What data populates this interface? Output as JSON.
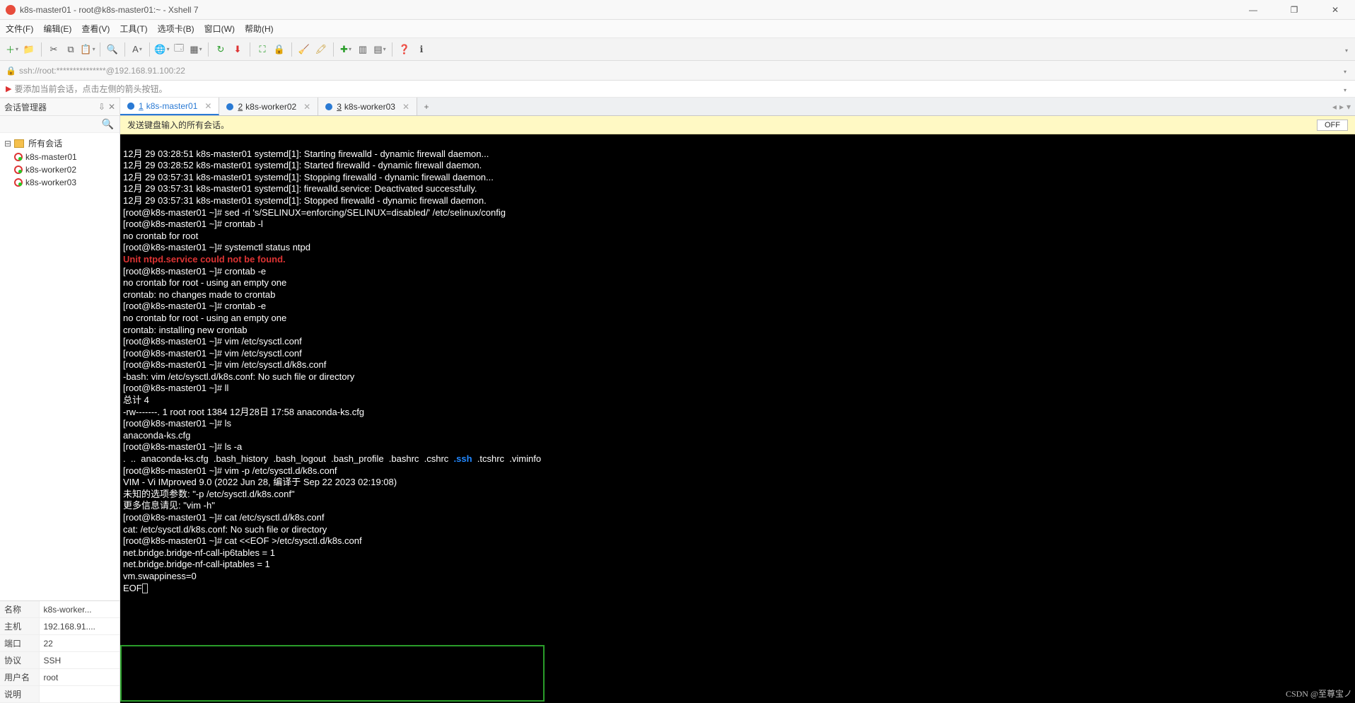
{
  "window": {
    "title": "k8s-master01 - root@k8s-master01:~ - Xshell 7",
    "min": "—",
    "max": "❐",
    "close": "✕"
  },
  "menu": {
    "file": "文件(F)",
    "edit": "编辑(E)",
    "view": "查看(V)",
    "tools": "工具(T)",
    "tab": "选项卡(B)",
    "window": "窗口(W)",
    "help": "帮助(H)"
  },
  "toolbar": {
    "new": "＋",
    "open": "📁",
    "cut": "✂",
    "copy": "⧉",
    "paste": "📋",
    "find": "🔍",
    "font": "A",
    "color": "🎨",
    "lang": "🌐",
    "props": "🗔",
    "grid": "▦",
    "refresh": "↻",
    "xftp": "⬇",
    "fullscreen": "⛶",
    "lock": "🔒",
    "clear": "🧹",
    "highlight": "🖍",
    "plus2": "✚",
    "layout": "▥",
    "tile": "▤",
    "help": "❓",
    "about": "ℹ"
  },
  "address": {
    "lock": "🔒",
    "url": "ssh://root:***************@192.168.91.100:22"
  },
  "hint": {
    "flag": "▶",
    "text": "要添加当前会话，点击左侧的箭头按钮。"
  },
  "left": {
    "title": "会话管理器",
    "pin": "⇩",
    "close": "✕",
    "search_icon": "🔍",
    "root": "所有会话",
    "sessions": [
      {
        "name": "k8s-master01"
      },
      {
        "name": "k8s-worker02"
      },
      {
        "name": "k8s-worker03"
      }
    ],
    "props": {
      "name_label": "名称",
      "name_val": "k8s-worker...",
      "host_label": "主机",
      "host_val": "192.168.91....",
      "port_label": "端口",
      "port_val": "22",
      "proto_label": "协议",
      "proto_val": "SSH",
      "user_label": "用户名",
      "user_val": "root",
      "desc_label": "说明",
      "desc_val": ""
    }
  },
  "tabs": {
    "t1_num": "1",
    "t1_name": " k8s-master01",
    "t2_num": "2",
    "t2_name": " k8s-worker02",
    "t3_num": "3",
    "t3_name": " k8s-worker03",
    "add": "+",
    "prev": "◂",
    "next": "▸",
    "menu": "▾"
  },
  "broadcast": {
    "text": "发送键盘输入的所有会话。",
    "off": "OFF"
  },
  "terminal": {
    "l01": "12月 29 03:28:51 k8s-master01 systemd[1]: Starting firewalld - dynamic firewall daemon...",
    "l02": "12月 29 03:28:52 k8s-master01 systemd[1]: Started firewalld - dynamic firewall daemon.",
    "l03": "12月 29 03:57:31 k8s-master01 systemd[1]: Stopping firewalld - dynamic firewall daemon...",
    "l04": "12月 29 03:57:31 k8s-master01 systemd[1]: firewalld.service: Deactivated successfully.",
    "l05": "12月 29 03:57:31 k8s-master01 systemd[1]: Stopped firewalld - dynamic firewall daemon.",
    "l06": "[root@k8s-master01 ~]# sed -ri 's/SELINUX=enforcing/SELINUX=disabled/' /etc/selinux/config",
    "l07": "[root@k8s-master01 ~]# crontab -l",
    "l08": "no crontab for root",
    "l09": "[root@k8s-master01 ~]# systemctl status ntpd",
    "l10": "Unit ntpd.service could not be found.",
    "l11": "[root@k8s-master01 ~]# crontab -e",
    "l12": "no crontab for root - using an empty one",
    "l13": "crontab: no changes made to crontab",
    "l14": "[root@k8s-master01 ~]# crontab -e",
    "l15": "no crontab for root - using an empty one",
    "l16": "crontab: installing new crontab",
    "l17": "[root@k8s-master01 ~]# vim /etc/sysctl.conf",
    "l18": "[root@k8s-master01 ~]# vim /etc/sysctl.conf",
    "l19": "[root@k8s-master01 ~]# vim /etc/sysctl.d/k8s.conf",
    "l20": "-bash: vim /etc/sysctl.d/k8s.conf: No such file or directory",
    "l21": "[root@k8s-master01 ~]# ll",
    "l22": "总计 4",
    "l23": "-rw-------. 1 root root 1384 12月28日 17:58 anaconda-ks.cfg",
    "l24": "[root@k8s-master01 ~]# ls",
    "l25": "anaconda-ks.cfg",
    "l26": "[root@k8s-master01 ~]# ls -a",
    "l27a": ".  ..  anaconda-ks.cfg  .bash_history  .bash_logout  .bash_profile  .bashrc  .cshrc  ",
    "l27b": ".ssh",
    "l27c": "  .tcshrc  .viminfo",
    "l28": "[root@k8s-master01 ~]# vim -p /etc/sysctl.d/k8s.conf",
    "l29": "VIM - Vi IMproved 9.0 (2022 Jun 28, 编译于 Sep 22 2023 02:19:08)",
    "l30": "未知的选项参数: \"-p /etc/sysctl.d/k8s.conf\"",
    "l31": "更多信息请见: \"vim -h\"",
    "l32": "[root@k8s-master01 ~]# cat /etc/sysctl.d/k8s.conf",
    "l33": "cat: /etc/sysctl.d/k8s.conf: No such file or directory",
    "l34": "[root@k8s-master01 ~]# cat <<EOF >/etc/sysctl.d/k8s.conf",
    "l35": "net.bridge.bridge-nf-call-ip6tables = 1",
    "l36": "net.bridge.bridge-nf-call-iptables = 1",
    "l37": "vm.swappiness=0",
    "l38": "EOF"
  },
  "watermark": "CSDN @至尊宝ノ"
}
